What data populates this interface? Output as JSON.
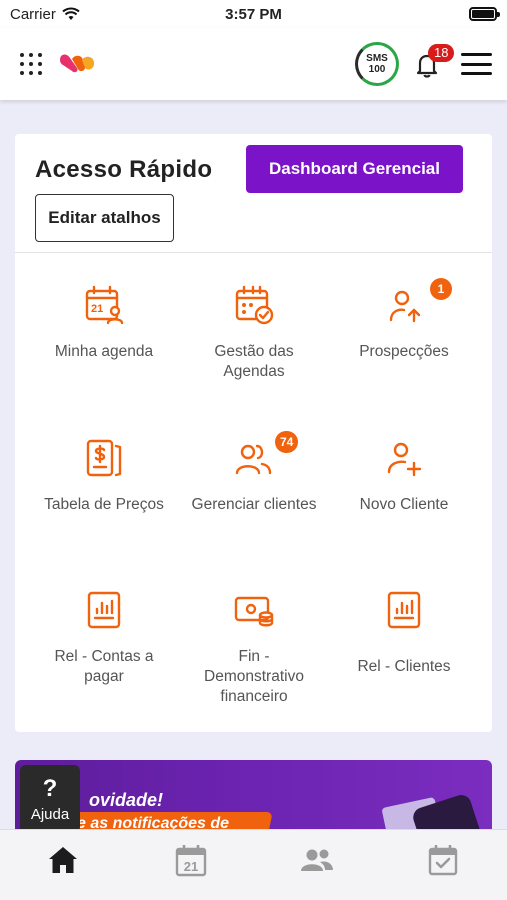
{
  "status_bar": {
    "carrier": "Carrier",
    "time": "3:57 PM"
  },
  "header": {
    "sms_line1": "SMS",
    "sms_line2": "100",
    "notification_count": "18"
  },
  "quick_access": {
    "title": "Acesso Rápido",
    "dashboard_button": "Dashboard Gerencial",
    "edit_button": "Editar atalhos",
    "items": [
      {
        "label": "Minha agenda",
        "icon": "calendar-user-icon",
        "badge": ""
      },
      {
        "label": "Gestão das Agendas",
        "icon": "calendar-check-icon",
        "badge": ""
      },
      {
        "label": "Prospecções",
        "icon": "user-arrow-up-icon",
        "badge": "1"
      },
      {
        "label": "Tabela de Preços",
        "icon": "price-table-icon",
        "badge": ""
      },
      {
        "label": "Gerenciar clientes",
        "icon": "users-icon",
        "badge": "74"
      },
      {
        "label": "Novo Cliente",
        "icon": "user-plus-icon",
        "badge": ""
      },
      {
        "label": "Rel - Contas a pagar",
        "icon": "report-icon",
        "badge": ""
      },
      {
        "label": "Fin - Demonstrativo financeiro",
        "icon": "money-icon",
        "badge": ""
      },
      {
        "label": "Rel - Clientes",
        "icon": "report-icon",
        "badge": ""
      }
    ]
  },
  "banner": {
    "line1": "ovidade!",
    "line2": "e as notificações de"
  },
  "help": {
    "label": "Ajuda",
    "symbol": "?"
  },
  "tabbar": {
    "items": [
      {
        "icon": "home-icon",
        "active": true
      },
      {
        "icon": "calendar-icon",
        "day": "21",
        "active": false
      },
      {
        "icon": "users-icon",
        "active": false
      },
      {
        "icon": "calendar-check-icon",
        "active": false
      }
    ]
  },
  "colors": {
    "accent_purple": "#7b14c9",
    "accent_orange": "#f0620d",
    "notification_red": "#d81b1b",
    "sms_green": "#2aa744"
  }
}
